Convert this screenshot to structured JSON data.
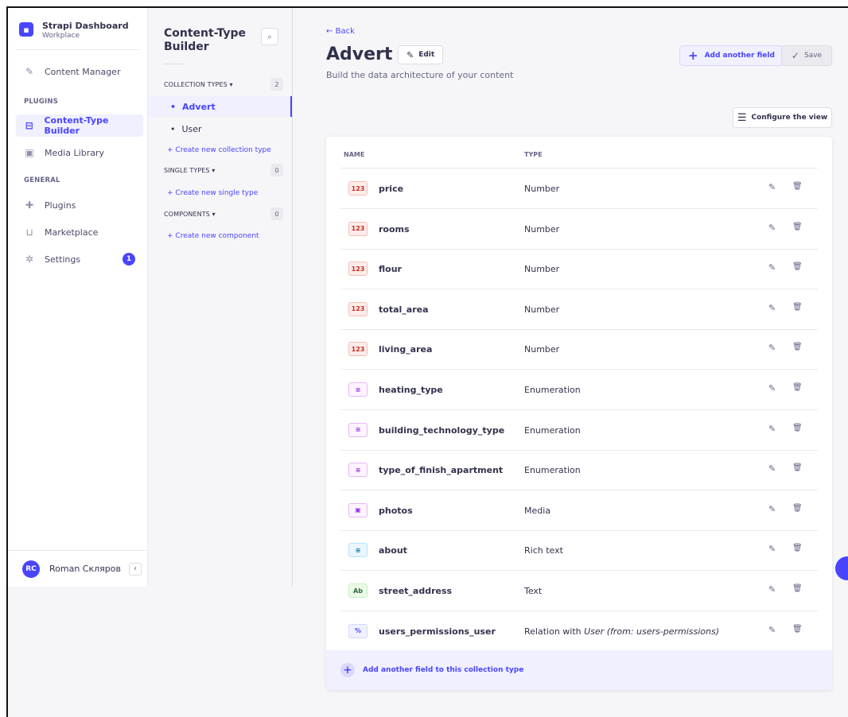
{
  "app": {
    "brand_title": "Strapi Dashboard",
    "brand_sub": "Workplace"
  },
  "mainnav": {
    "content_manager": "Content Manager",
    "plugins_section": "PLUGINS",
    "ctb": "Content-Type Builder",
    "media_library": "Media Library",
    "general_section": "GENERAL",
    "plugins": "Plugins",
    "marketplace": "Marketplace",
    "settings": "Settings",
    "settings_badge": "1",
    "user_initials": "RC",
    "user_name": "Roman Скляров",
    "collapse": "‹"
  },
  "subnav": {
    "title": "Content-Type Builder",
    "collection_types": "COLLECTION TYPES",
    "collection_count": "2",
    "collection_items": [
      "Advert",
      "User"
    ],
    "create_collection": "Create new collection type",
    "single_types": "SINGLE TYPES",
    "single_count": "0",
    "create_single": "Create new single type",
    "components": "COMPONENTS",
    "components_count": "0",
    "create_component": "Create new component"
  },
  "header": {
    "back": "Back",
    "title": "Advert",
    "edit": "Edit",
    "subtitle": "Build the data architecture of your content",
    "add_field": "Add another field",
    "save": "Save",
    "configure": "Configure the view"
  },
  "table": {
    "col_name": "NAME",
    "col_type": "TYPE",
    "rows": [
      {
        "icon": "123",
        "name": "price",
        "type": "Number"
      },
      {
        "icon": "123",
        "name": "rooms",
        "type": "Number"
      },
      {
        "icon": "123",
        "name": "flour",
        "type": "Number"
      },
      {
        "icon": "123",
        "name": "total_area",
        "type": "Number"
      },
      {
        "icon": "123",
        "name": "living_area",
        "type": "Number"
      },
      {
        "icon": "≡",
        "name": "heating_type",
        "type": "Enumeration"
      },
      {
        "icon": "≡",
        "name": "building_technology_type",
        "type": "Enumeration"
      },
      {
        "icon": "≡",
        "name": "type_of_finish_apartment",
        "type": "Enumeration"
      },
      {
        "icon": "▣",
        "name": "photos",
        "type": "Media"
      },
      {
        "icon": "≡",
        "name": "about",
        "type": "Rich text"
      },
      {
        "icon": "Ab",
        "name": "street_address",
        "type": "Text"
      },
      {
        "icon": "%",
        "name": "users_permissions_user",
        "type": "Relation with",
        "type_extra": "User (from: users-permissions)"
      }
    ],
    "footer_add": "Add another field to this collection type"
  },
  "colors": {
    "primary": "#4945ff",
    "number": "#d02b20",
    "enumeration": "#9736e8",
    "richtext": "#0c75af",
    "text": "#2f6846"
  }
}
